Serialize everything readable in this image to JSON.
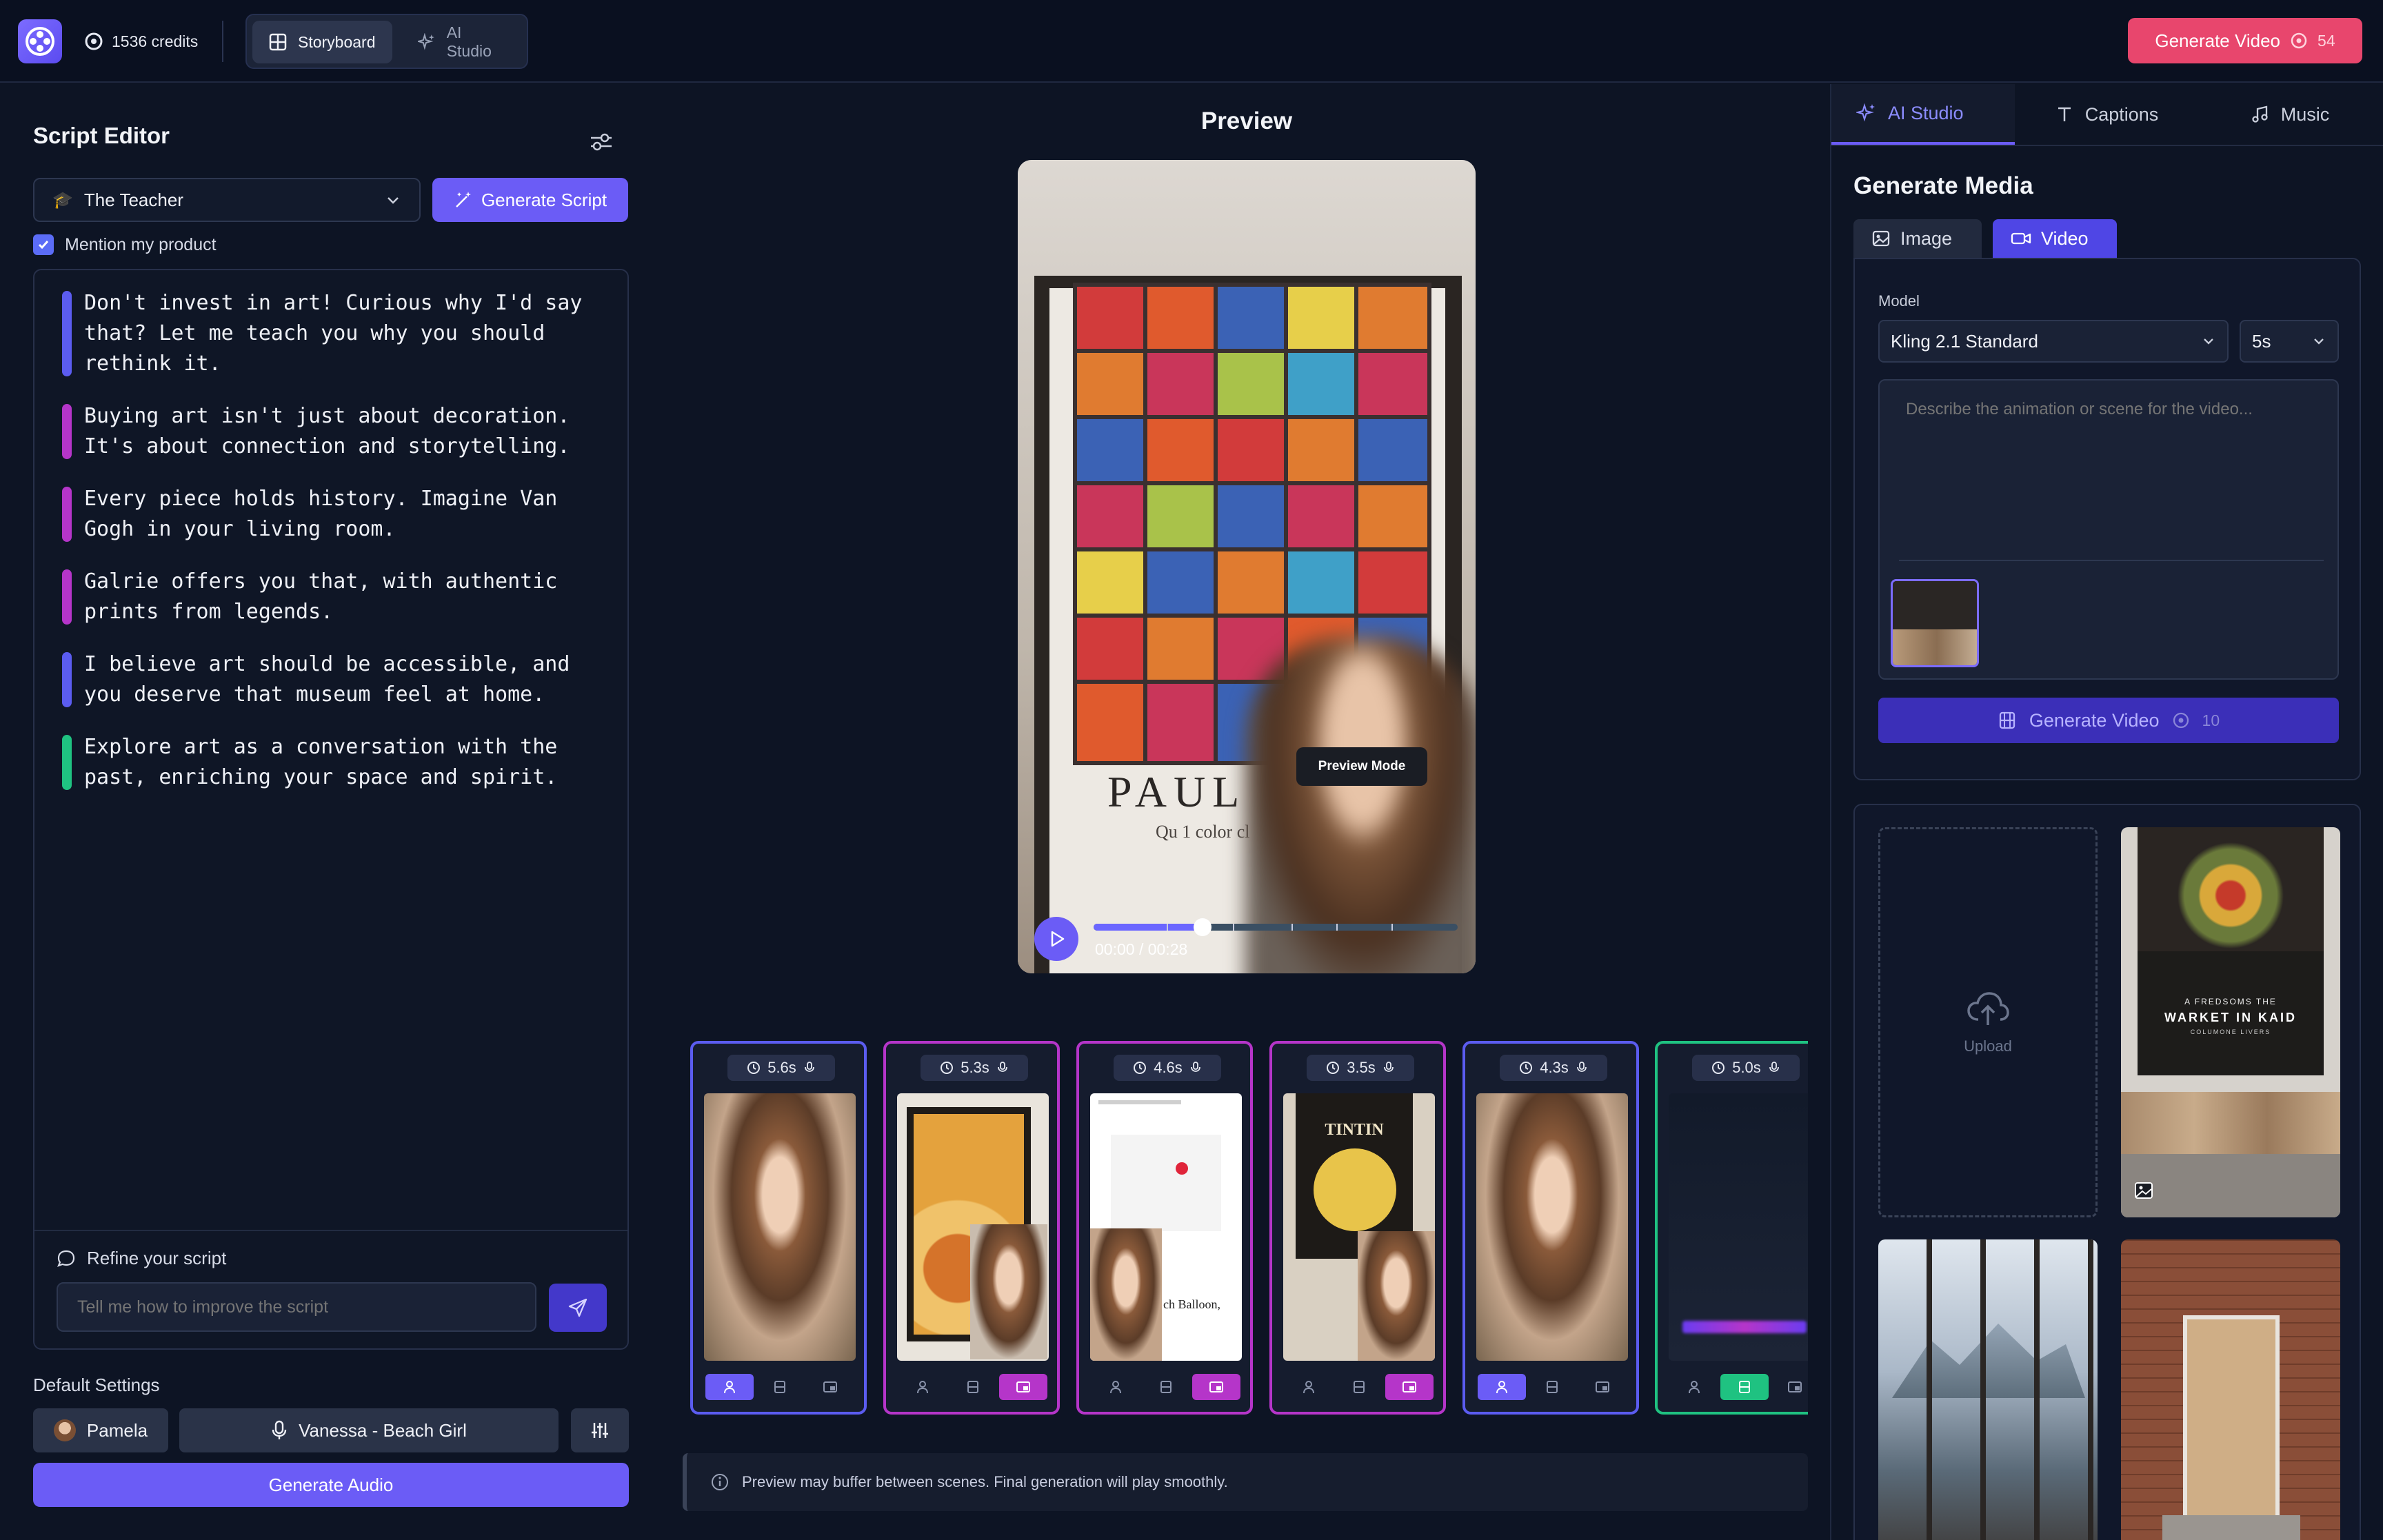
{
  "topbar": {
    "credits": "1536 credits",
    "tabs": [
      {
        "label": "Storyboard",
        "active": true
      },
      {
        "label": "AI Studio",
        "active": false
      }
    ],
    "generate_video": {
      "label": "Generate Video",
      "cost": "54"
    }
  },
  "script_editor": {
    "title": "Script Editor",
    "persona": "The Teacher",
    "generate_script": "Generate Script",
    "mention_product": {
      "label": "Mention my product",
      "checked": true
    },
    "paragraphs": [
      {
        "text": "Don't invest in art! Curious why I'd say that? Let me teach you why you should rethink it.",
        "color": "#5b5cf0"
      },
      {
        "text": "Buying art isn't just about decoration. It's about connection and storytelling.",
        "color": "#b535c9"
      },
      {
        "text": "Every piece holds history. Imagine Van Gogh in your living room.",
        "color": "#b535c9"
      },
      {
        "text": "Galrie offers you that, with authentic prints from legends.",
        "color": "#b535c9"
      },
      {
        "text": "I believe art should be accessible, and you deserve that museum feel at home.",
        "color": "#5b5cf0"
      },
      {
        "text": "Explore art as a conversation with the past, enriching your space and spirit.",
        "color": "#1fc281"
      }
    ],
    "refine": {
      "label": "Refine your script",
      "placeholder": "Tell me how to improve the script"
    }
  },
  "defaults": {
    "label": "Default Settings",
    "avatar": "Pamela",
    "voice": "Vanessa - Beach Girl",
    "generate_audio": "Generate Audio"
  },
  "preview": {
    "title": "Preview",
    "mode_badge": "Preview Mode",
    "time": "00:00 / 00:28",
    "progress_fraction": 0.3,
    "poster_text": "PAUL",
    "poster_sub": "Qu 1 color cl"
  },
  "scenes": [
    {
      "duration": "5.6s",
      "border": "#5b5cf0",
      "active_tool": 0
    },
    {
      "duration": "5.3s",
      "border": "#b535c9",
      "active_tool": 2
    },
    {
      "duration": "4.6s",
      "border": "#b535c9",
      "active_tool": 2
    },
    {
      "duration": "3.5s",
      "border": "#b535c9",
      "active_tool": 2
    },
    {
      "duration": "4.3s",
      "border": "#5b5cf0",
      "active_tool": 0
    },
    {
      "duration": "5.0s",
      "border": "#1fc281",
      "active_tool": 1
    }
  ],
  "scene_text": {
    "s3_caption": "ch Balloon,",
    "s4_title": "TINTIN"
  },
  "notice": "Preview may buffer between scenes. Final generation will play smoothly.",
  "right_panel": {
    "tabs": [
      {
        "label": "AI Studio",
        "active": true
      },
      {
        "label": "Captions",
        "active": false
      },
      {
        "label": "Music",
        "active": false
      }
    ],
    "title": "Generate Media",
    "media_types": [
      {
        "label": "Image",
        "active": false
      },
      {
        "label": "Video",
        "active": true
      }
    ],
    "model_label": "Model",
    "model": "Kling 2.1 Standard",
    "duration": "5s",
    "prompt_placeholder": "Describe the animation or scene for the video...",
    "generate_video": {
      "label": "Generate Video",
      "cost": "10"
    },
    "upload_label": "Upload",
    "market_poster": {
      "line1": "A FREDSOMS THE",
      "line2": "WARKET IN KAID",
      "line3": "COLUMONE LIVERS"
    }
  },
  "colors": {
    "accent": "#6b5cf6",
    "danger": "#e8466d",
    "bg": "#0d1424"
  }
}
